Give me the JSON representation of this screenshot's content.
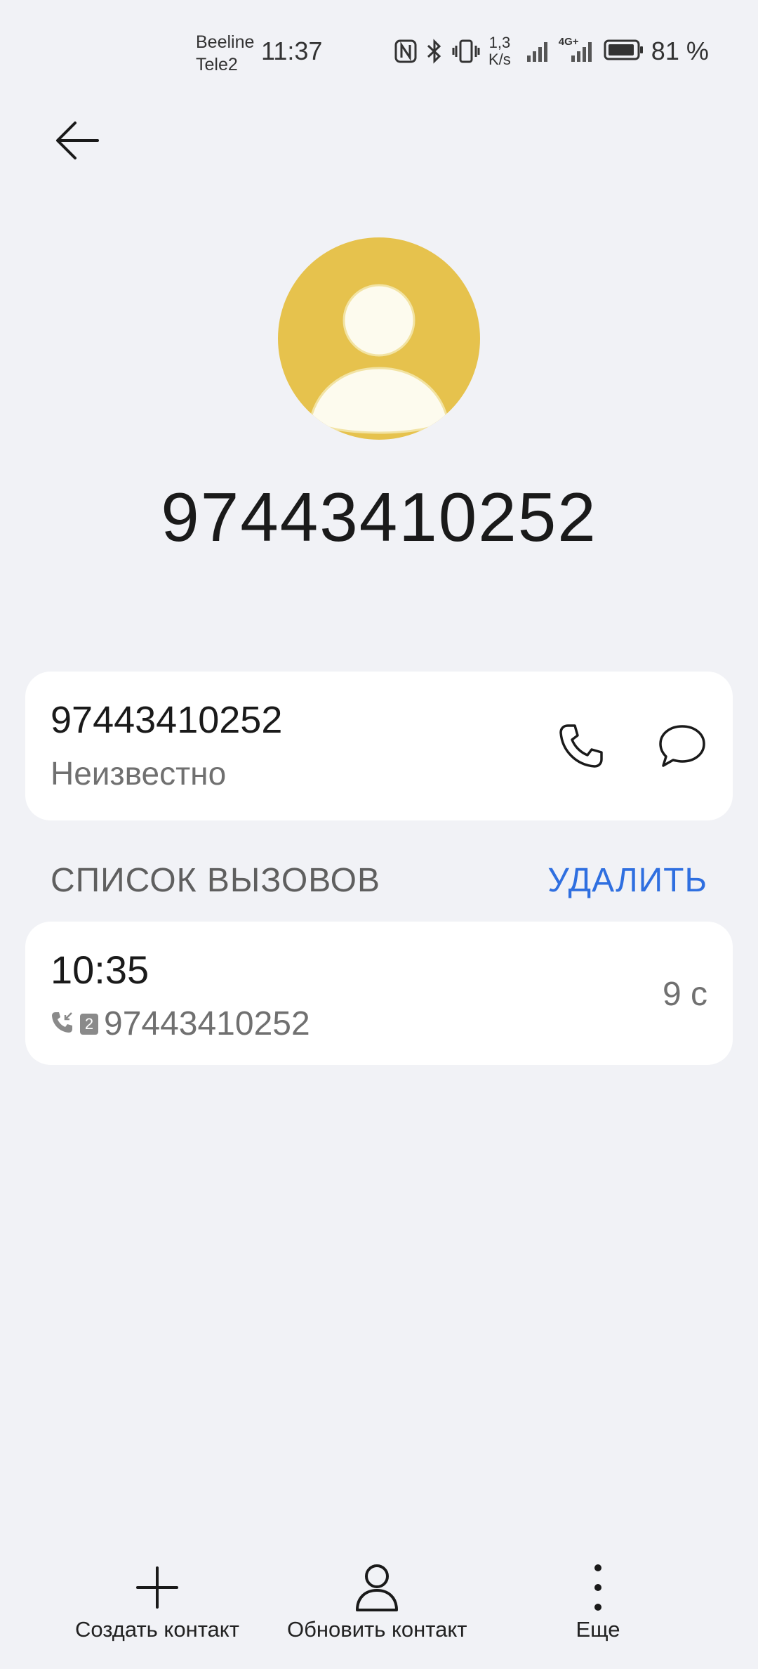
{
  "status_bar": {
    "carrier_1": "Beeline",
    "carrier_2": "Tele2",
    "time": "11:37",
    "net_speed_value": "1,3",
    "net_speed_unit": "K/s",
    "network_type": "4G+",
    "battery_percent": "81 %",
    "icons": [
      "nfc-icon",
      "bluetooth-icon",
      "vibrate-icon",
      "signal-icon",
      "signal-4g-icon",
      "battery-icon"
    ]
  },
  "header": {
    "back_icon": "arrow-left-icon"
  },
  "contact": {
    "avatar_icon": "person-icon",
    "avatar_color": "#e6c24d",
    "display_number": "97443410252",
    "number": "97443410252",
    "label": "Неизвестно"
  },
  "call_log": {
    "section_title": "СПИСОК ВЫЗОВОВ",
    "delete_label": "УДАЛИТЬ",
    "accent_color": "#2f6fe0",
    "entries": [
      {
        "time": "10:35",
        "sim": "2",
        "number": "97443410252",
        "duration": "9 с",
        "type_icon": "incoming-call-icon"
      }
    ]
  },
  "bottom_bar": {
    "create_label": "Создать контакт",
    "update_label": "Обновить контакт",
    "more_label": "Еще"
  }
}
